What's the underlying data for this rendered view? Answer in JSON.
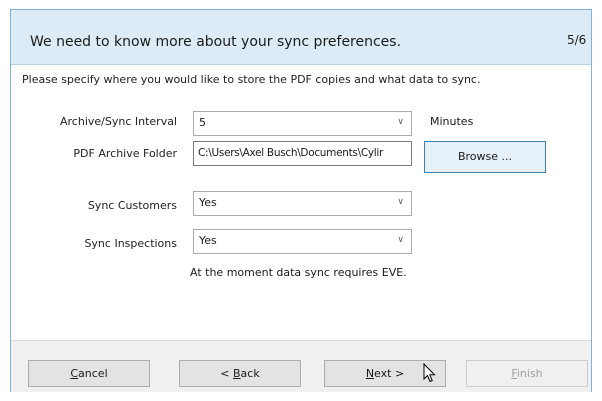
{
  "header": {
    "title": "We need to know more about your sync preferences.",
    "step": "5/6"
  },
  "intro": "Please specify where you would like to store the PDF copies and what data to sync.",
  "fields": {
    "interval": {
      "label": "Archive/Sync Interval",
      "value": "5",
      "unit": "Minutes"
    },
    "pdf_folder": {
      "label": "PDF Archive Folder",
      "value": "C:\\Users\\Axel Busch\\Documents\\Cylir"
    },
    "customers": {
      "label": "Sync Customers",
      "value": "Yes"
    },
    "inspections": {
      "label": "Sync Inspections",
      "value": "Yes"
    }
  },
  "browse_label": "Browse ...",
  "note": "At the moment data sync requires EVE.",
  "buttons": {
    "cancel": "Cancel",
    "back": "< Back",
    "next": "Next >",
    "finish": "Finish"
  },
  "icons": {
    "dropdown": "chevron-down-icon",
    "cursor": "mouse-pointer-icon"
  },
  "colors": {
    "header_bg": "#dcebf6",
    "accent_border": "#3c7fb1",
    "footer_bg": "#f0f0f0"
  }
}
